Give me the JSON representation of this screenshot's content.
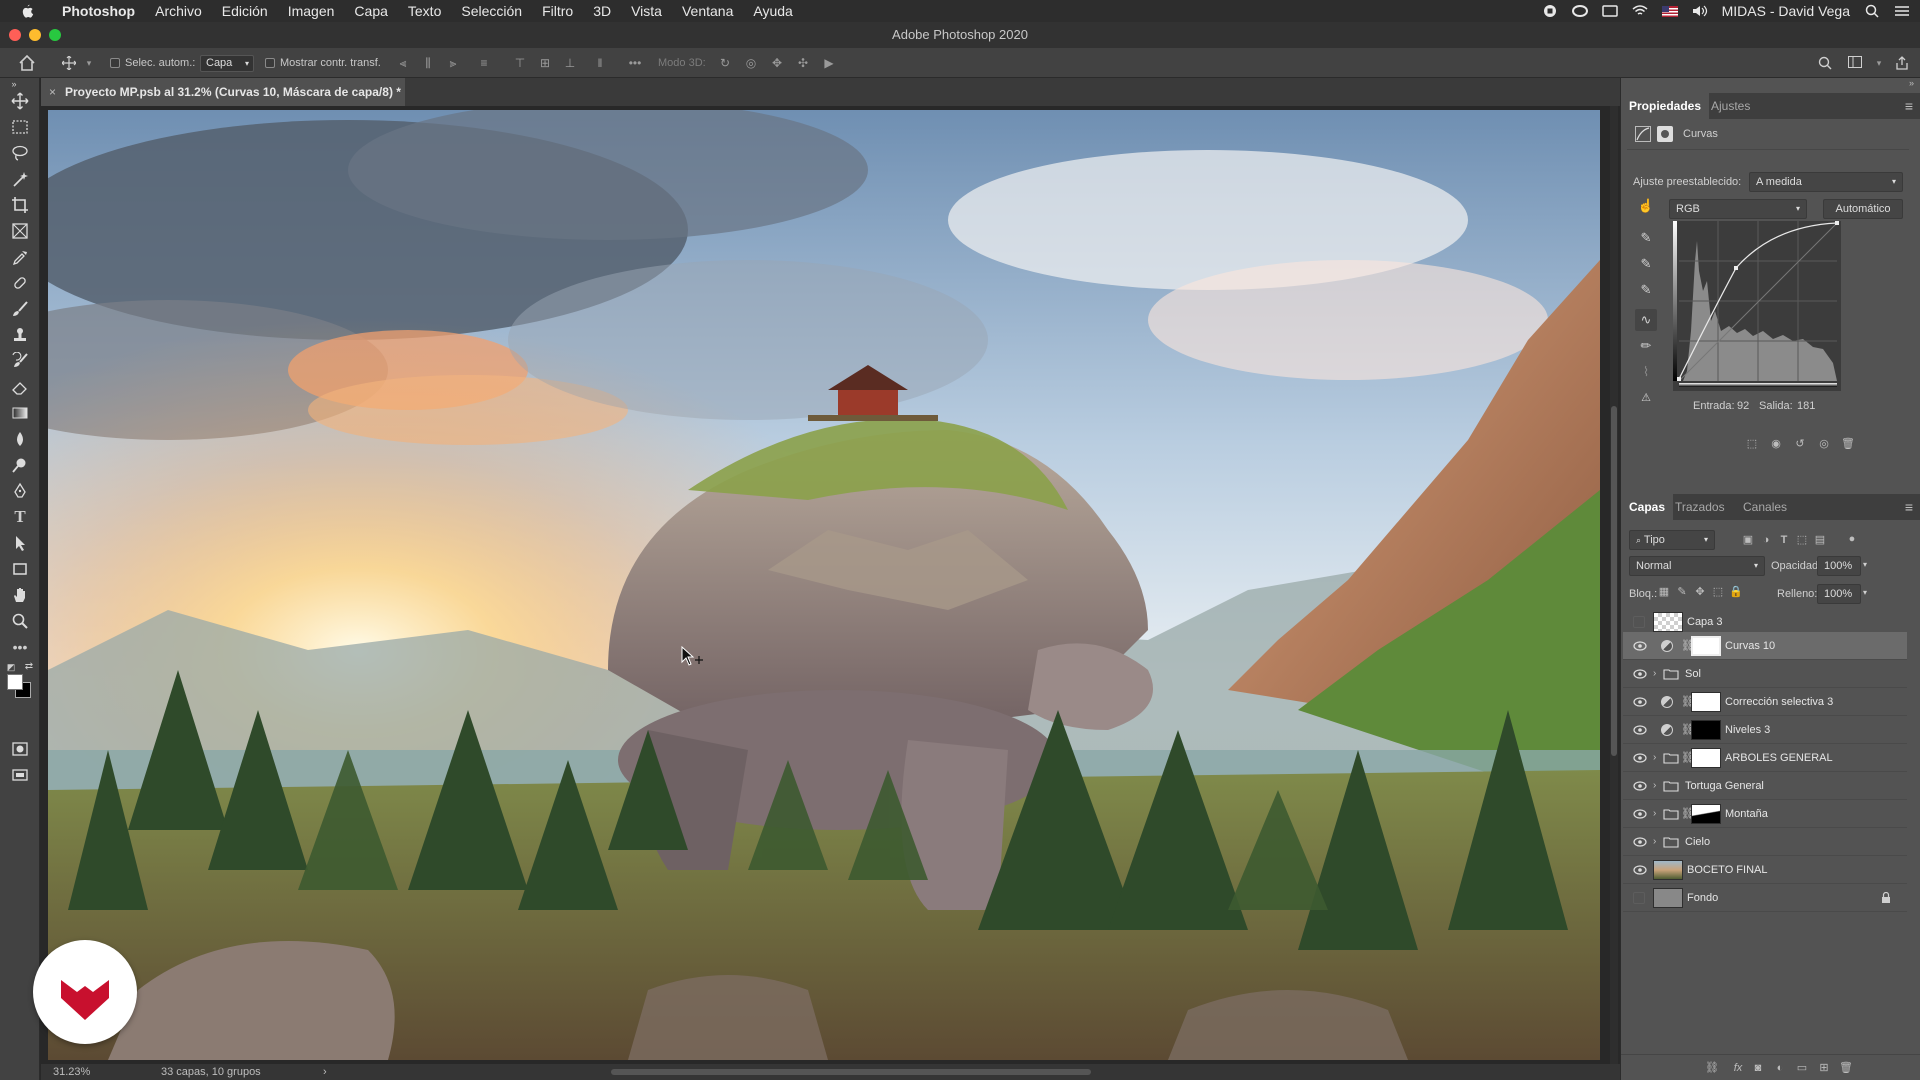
{
  "menubar": {
    "app_name": "Photoshop",
    "items": [
      "Archivo",
      "Edición",
      "Imagen",
      "Capa",
      "Texto",
      "Selección",
      "Filtro",
      "3D",
      "Vista",
      "Ventana",
      "Ayuda"
    ],
    "user": "MIDAS - David Vega"
  },
  "window": {
    "title": "Adobe Photoshop 2020"
  },
  "options": {
    "auto_select_label": "Selec. autom.:",
    "auto_select_value": "Capa",
    "show_transform_label": "Mostrar contr. transf.",
    "mode3d_label": "Modo 3D:"
  },
  "document": {
    "tab_title": "Proyecto MP.psb al 31.2% (Curvas 10, Máscara de capa/8) *",
    "close_glyph": "×"
  },
  "status": {
    "zoom": "31.23%",
    "info": "33 capas, 10 grupos",
    "arrow": "›"
  },
  "properties": {
    "tabs": [
      "Propiedades",
      "Ajustes"
    ],
    "header": "Curvas",
    "preset_label": "Ajuste preestablecido:",
    "preset_value": "A medida",
    "channel": "RGB",
    "auto_button": "Automático",
    "input_label": "Entrada:",
    "input_value": "92",
    "output_label": "Salida:",
    "output_value": "181"
  },
  "layers_panel": {
    "tabs": [
      "Capas",
      "Trazados",
      "Canales"
    ],
    "filter": "Tipo",
    "blend_mode": "Normal",
    "opacity_label": "Opacidad:",
    "opacity_value": "100%",
    "lock_label": "Bloq.:",
    "fill_label": "Relleno:",
    "fill_value": "100%",
    "layers": [
      {
        "name": "Capa 3",
        "visible": false,
        "kind": "pixel"
      },
      {
        "name": "Curvas 10",
        "visible": true,
        "kind": "adjustment",
        "selected": true
      },
      {
        "name": "Sol",
        "visible": true,
        "kind": "group"
      },
      {
        "name": "Corrección selectiva 3",
        "visible": true,
        "kind": "adjustment"
      },
      {
        "name": "Niveles 3",
        "visible": true,
        "kind": "adjustment"
      },
      {
        "name": "ARBOLES GENERAL",
        "visible": true,
        "kind": "group-masked"
      },
      {
        "name": "Tortuga General",
        "visible": true,
        "kind": "group"
      },
      {
        "name": "Montaña",
        "visible": true,
        "kind": "group-masked"
      },
      {
        "name": "Cielo",
        "visible": true,
        "kind": "group"
      },
      {
        "name": "BOCETO FINAL",
        "visible": true,
        "kind": "image"
      },
      {
        "name": "Fondo",
        "visible": false,
        "kind": "background"
      }
    ]
  },
  "colors": {
    "accent_red": "#c8102e",
    "panel_bg": "#535353",
    "selected_row": "#6b6b6b"
  }
}
